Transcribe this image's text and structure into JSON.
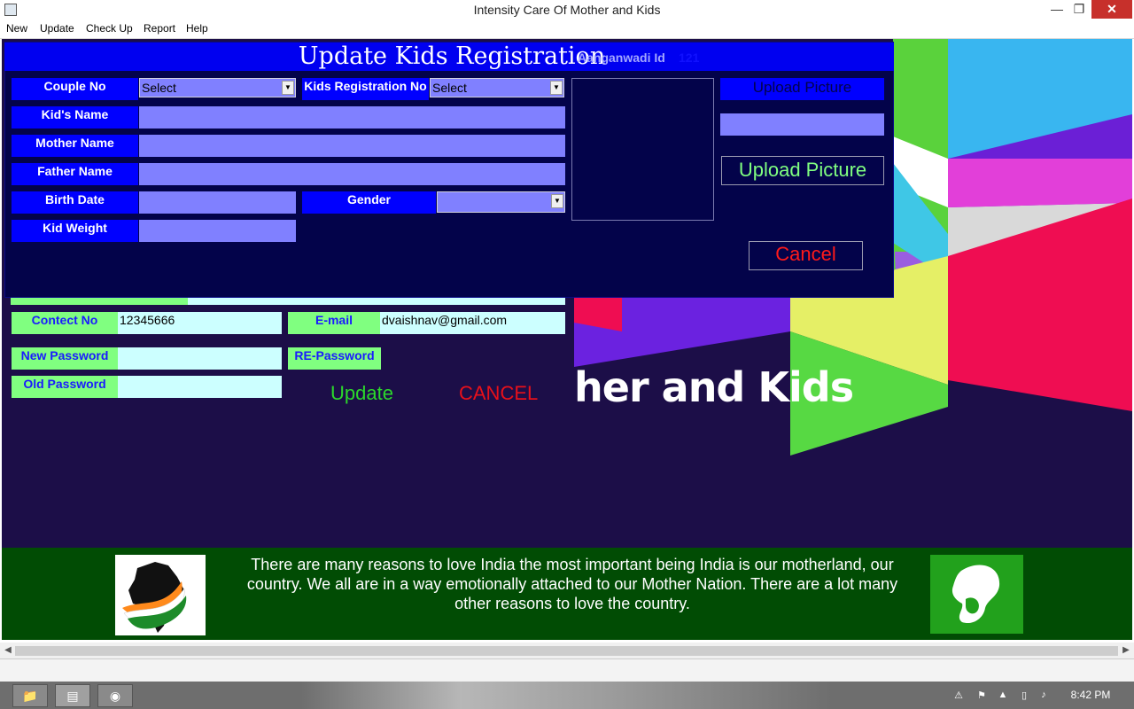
{
  "window": {
    "title": "Intensity Care Of Mother and Kids",
    "minimize": "—",
    "maximize": "❐",
    "close": "✕"
  },
  "menu": [
    "New",
    "Update",
    "Check Up",
    "Report",
    "Help"
  ],
  "background_form": {
    "contact_label": "Contect No",
    "contact_value": "12345666",
    "email_label": "E-mail",
    "email_value": "dvaishnav@gmail.com",
    "new_password_label": "New Password",
    "re_password_label": "RE-Password",
    "old_password_label": "Old Password",
    "update_button": "Update",
    "cancel_button": "CANCEL",
    "banner_text_partial": "her and Kids"
  },
  "dialog": {
    "title": "Update Kids Registration",
    "aanganwadi_label": "Aanganwadi Id",
    "aanganwadi_value": "121",
    "couple_no_label": "Couple No",
    "couple_no_value": "Select",
    "kids_reg_label": "Kids Registration No",
    "kids_reg_value": "Select",
    "kid_name_label": "Kid's Name",
    "mother_name_label": "Mother Name",
    "father_name_label": "Father Name",
    "birth_date_label": "Birth Date",
    "gender_label": "Gender",
    "kid_weight_label": "Kid Weight",
    "upload_picture_label": "Upload Picture",
    "upload_picture_button": "Upload Picture",
    "cancel_button": "Cancel"
  },
  "footer": {
    "text": "There are many reasons to love India the most important being India is our motherland, our country. We all are in a way emotionally attached to our Mother Nation. There are a lot many other reasons to love the country."
  },
  "taskbar": {
    "clock": "8:42 PM"
  },
  "colors": {
    "dialog_bg": "#03034a",
    "dialog_title_bg": "#0000f0",
    "label_blue": "#0000ff",
    "input_fill": "#8080ff",
    "bg_label_green": "#80ff80",
    "bg_field_cyan": "#ccffff",
    "main_bg": "#1c0e48",
    "footer_bg": "#014c04"
  }
}
